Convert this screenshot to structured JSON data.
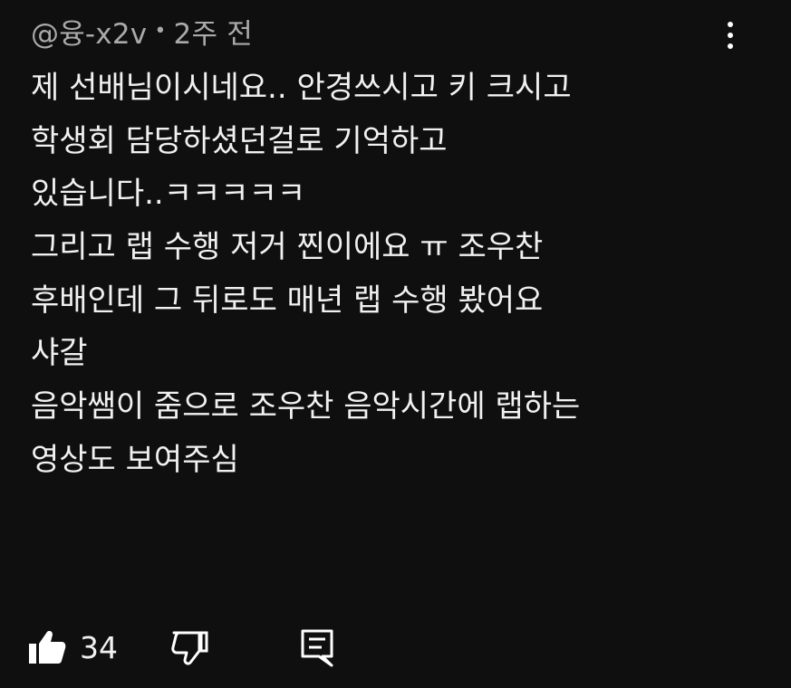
{
  "comment": {
    "author": "@융-x2v",
    "separator": "•",
    "time": "2주 전",
    "lines": [
      "제 선배님이시네요.. 안경쓰시고 키 크시고",
      "학생회 담당하셨던걸로 기억하고",
      "있습니다..ㅋㅋㅋㅋㅋ",
      "그리고 랩 수행 저거 찐이에요 ㅠ 조우찬",
      "후배인데 그 뒤로도 매년 랩 수행 봤어요",
      "샤갈",
      "음악쌤이 줌으로 조우찬 음악시간에 랩하는",
      "영상도 보여주심"
    ],
    "like_count": "34"
  },
  "icons": {
    "menu": "more-vert-icon",
    "like": "thumb-up-icon",
    "dislike": "thumb-down-icon",
    "reply": "comment-reply-icon"
  },
  "colors": {
    "background": "#0f0f0f",
    "text": "#f1f1f1",
    "meta": "#aaaaaa"
  }
}
